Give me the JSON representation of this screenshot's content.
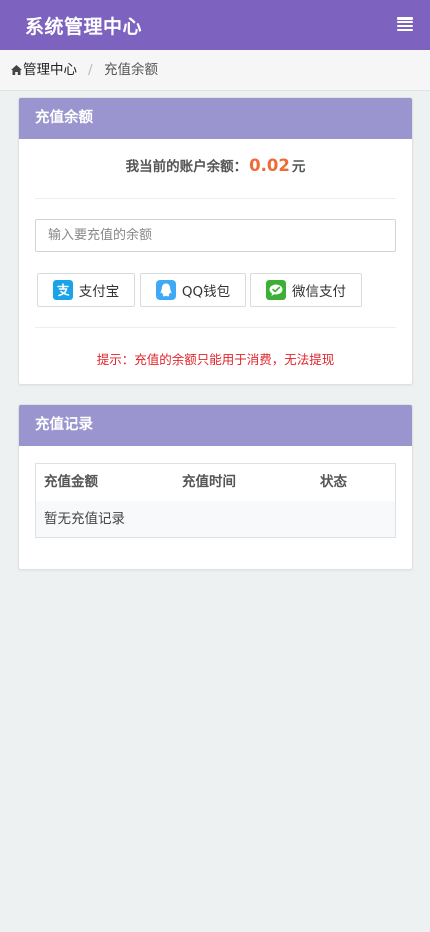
{
  "header": {
    "title": "系统管理中心",
    "menu_icon": "bars-icon",
    "color": "#7d62c0"
  },
  "breadcrumb": {
    "home_icon": "home-icon",
    "home": "管理中心",
    "separator": "/",
    "current": "充值余额"
  },
  "balance_panel": {
    "title": "充值余额",
    "balance_label": "我当前的账户余额：",
    "balance_value": "0.02",
    "balance_unit": "元",
    "input_placeholder": "输入要充值的余额",
    "pay_methods": [
      {
        "label": "支付宝",
        "icon": "alipay-icon",
        "color": "#1aa3e8"
      },
      {
        "label": "QQ钱包",
        "icon": "qq-wallet-icon",
        "color": "#3fa9f5"
      },
      {
        "label": "微信支付",
        "icon": "wechat-pay-icon",
        "color": "#3cb034"
      }
    ],
    "tip": "提示：充值的余额只能用于消费，无法提现"
  },
  "records_panel": {
    "title": "充值记录",
    "columns": [
      "充值金额",
      "充值时间",
      "状态"
    ],
    "empty_text": "暂无充值记录"
  }
}
